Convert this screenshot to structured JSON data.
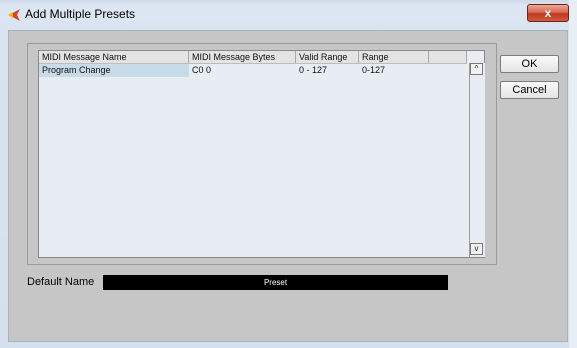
{
  "window": {
    "title": "Add Multiple Presets",
    "close_symbol": "x"
  },
  "table": {
    "columns": [
      "MIDI Message Name",
      "MIDI Message Bytes",
      "Valid Range",
      "Range"
    ],
    "rows": [
      [
        "Program Change",
        "C0 0",
        "0 - 127",
        "0-127"
      ]
    ],
    "scroll_up_symbol": "^",
    "scroll_down_symbol": "v"
  },
  "buttons": {
    "ok": "OK",
    "cancel": "Cancel"
  },
  "default_name": {
    "label": "Default Name",
    "value": "Preset"
  },
  "colors": {
    "accent": "#d6422b",
    "selection": "#c7dbe9",
    "field_bg": "#000000",
    "panel_bg": "#c6c6c6"
  }
}
